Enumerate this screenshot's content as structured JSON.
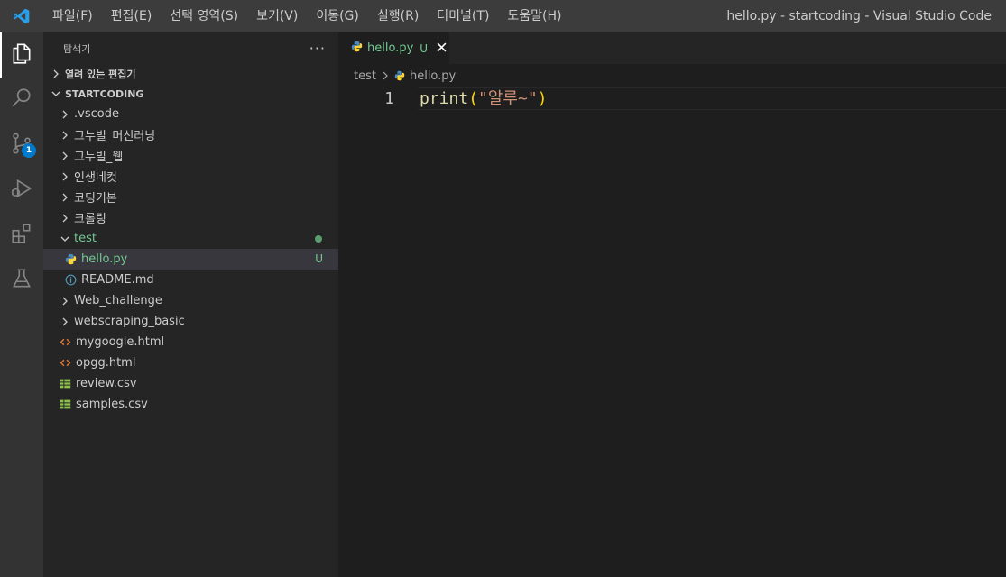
{
  "titlebar": {
    "menu": [
      "파일(F)",
      "편집(E)",
      "선택 영역(S)",
      "보기(V)",
      "이동(G)",
      "실행(R)",
      "터미널(T)",
      "도움말(H)"
    ],
    "window_title": "hello.py - startcoding - Visual Studio Code"
  },
  "activitybar": {
    "items": [
      "files-icon",
      "search-icon",
      "source-control-icon",
      "run-debug-icon",
      "extensions-icon",
      "testing-icon"
    ],
    "source_control_badge": "1",
    "accent_color": "#007acc"
  },
  "sidebar": {
    "title": "탐색기",
    "more": "···",
    "open_editors_label": "열려 있는 편집기",
    "workspace_label": "STARTCODING",
    "tree": [
      {
        "label": ".vscode",
        "type": "folder"
      },
      {
        "label": "그누빌_머신러닝",
        "type": "folder"
      },
      {
        "label": "그누빌_웹",
        "type": "folder"
      },
      {
        "label": "인생네컷",
        "type": "folder"
      },
      {
        "label": "코딩기본",
        "type": "folder"
      },
      {
        "label": "크롤링",
        "type": "folder"
      },
      {
        "label": "test",
        "type": "folder-open"
      },
      {
        "label": "hello.py",
        "type": "python",
        "status": "U"
      },
      {
        "label": "README.md",
        "type": "info"
      },
      {
        "label": "Web_challenge",
        "type": "folder"
      },
      {
        "label": "webscraping_basic",
        "type": "folder"
      },
      {
        "label": "mygoogle.html",
        "type": "html"
      },
      {
        "label": "opgg.html",
        "type": "html"
      },
      {
        "label": "review.csv",
        "type": "csv"
      },
      {
        "label": "samples.csv",
        "type": "csv"
      }
    ]
  },
  "editor": {
    "tab_label": "hello.py",
    "tab_status": "U",
    "breadcrumb": [
      "test",
      "hello.py"
    ],
    "line_number": "1",
    "code": {
      "fn": "print",
      "open": "(",
      "str": "\"알루~\"",
      "close": ")"
    }
  }
}
